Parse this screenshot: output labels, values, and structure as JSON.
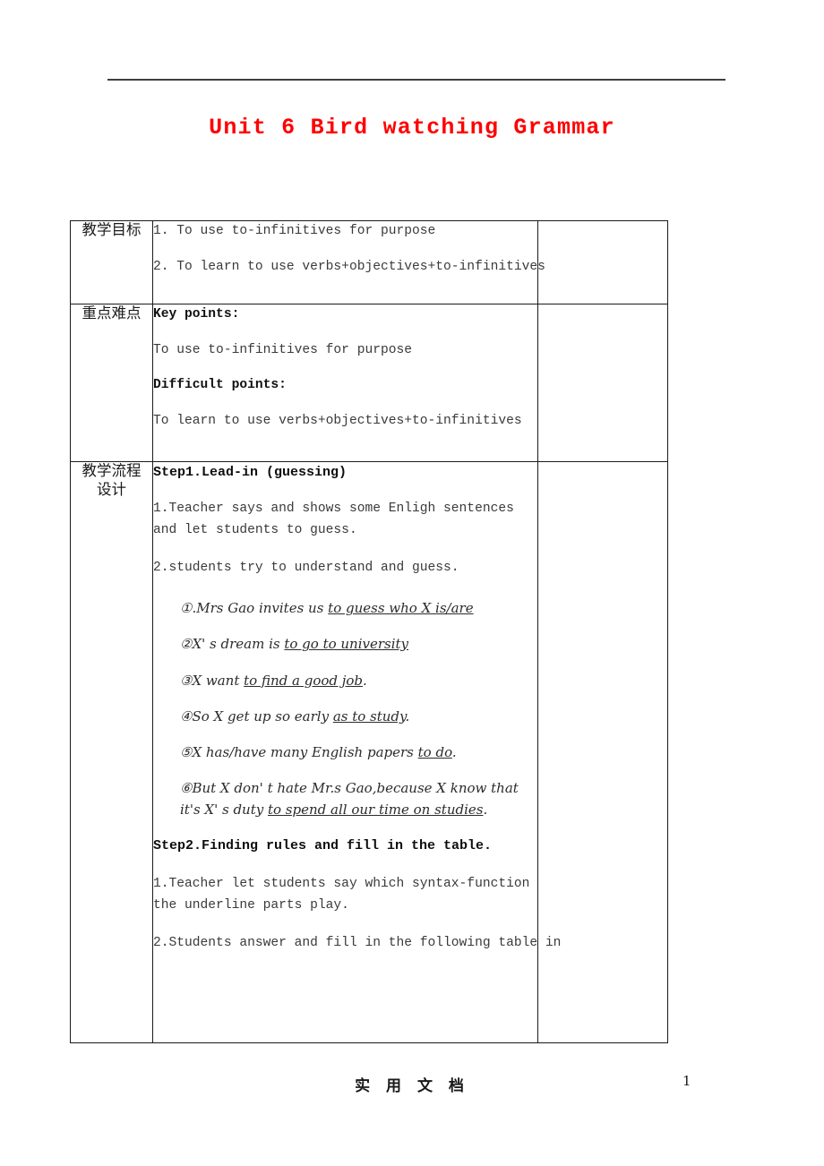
{
  "document": {
    "title": "Unit 6 Bird watching Grammar",
    "title_color": "#ff0000"
  },
  "footer": {
    "center_text": "实 用 文 档",
    "page_number": "1"
  },
  "table": {
    "rows": [
      {
        "label": "教学目标",
        "label_lines": [
          "教学目标"
        ],
        "lines": [
          "1. To use to-infinitives for purpose",
          "2. To learn to use verbs+objectives+to-infinitives"
        ],
        "extra": ""
      },
      {
        "label": "重点难点",
        "label_lines": [
          "重点难点"
        ],
        "lines": [
          "Key points:",
          " To use to-infinitives for purpose",
          "Difficult points:",
          "To learn to use verbs+objectives+to-infinitives"
        ],
        "extra": ""
      },
      {
        "label": "教学流程设计",
        "label_lines": [
          "教学流程",
          "设计"
        ],
        "extra": "",
        "step1_heading": "Step1.Lead-in (guessing)",
        "step1_item1": "1.Teacher says and shows some Enligh sentences and let students to guess.",
        "step1_item2": "2.students try to understand and guess.",
        "examples": [
          {
            "marker": "①.",
            "plain_before": "Mrs Gao invites us ",
            "underlined": "to guess who X is/are",
            "plain_after": ""
          },
          {
            "marker": "②",
            "plain_before": "X' s dream is ",
            "underlined": "to go to university",
            "plain_after": ""
          },
          {
            "marker": "③",
            "plain_before": "X want ",
            "underlined": "to find a good job",
            "plain_after": "."
          },
          {
            "marker": "④",
            "plain_before": "So X get up so early ",
            "underlined": "as to study",
            "plain_after": "."
          },
          {
            "marker": "⑤",
            "plain_before": "X has/have many English papers ",
            "underlined": "to do",
            "plain_after": "."
          },
          {
            "marker": "⑥",
            "plain_before": "But X don' t hate Mr.s Gao,because X know that it's X' s duty ",
            "underlined": "to spend all our time on studies",
            "plain_after": "."
          }
        ],
        "step2_heading": "Step2.Finding rules and fill in the table.",
        "step2_item1": "1.Teacher let students say which syntax-function the underline parts play.",
        "step2_item2": "2.Students answer and fill in the following table in"
      }
    ]
  }
}
